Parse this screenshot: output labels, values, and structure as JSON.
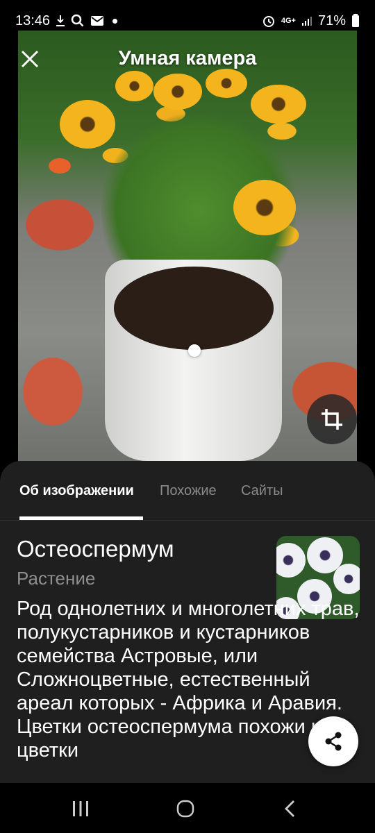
{
  "status_bar": {
    "time": "13:46",
    "battery": "71%",
    "network": "4G+",
    "icons": [
      "download-icon",
      "search-icon",
      "mail-icon",
      "notification-dot",
      "alarm-icon",
      "signal-icon",
      "battery-icon"
    ]
  },
  "viewer": {
    "title": "Умная камера",
    "close_icon": "close-icon",
    "crop_icon": "crop-icon"
  },
  "tabs": [
    {
      "label": "Об изображении",
      "active": true
    },
    {
      "label": "Похожие",
      "active": false
    },
    {
      "label": "Сайты",
      "active": false
    }
  ],
  "result": {
    "title": "Остеоспермум",
    "subtitle": "Растение",
    "description": "Род однолетних и многолетних трав, полукустарников и кустарников семейства Астровые, или Сложноцветные, естественный ареал которых - Африка и Аравия. Цветки остеоспермума похожи на цветки"
  },
  "actions": {
    "share_icon": "share-icon"
  },
  "nav": {
    "icons": [
      "recents-icon",
      "home-icon",
      "back-icon"
    ]
  },
  "colors": {
    "sheet_bg": "#1f1f1f",
    "tab_inactive": "#8a8a8a",
    "subtitle": "#8f8f8f"
  }
}
